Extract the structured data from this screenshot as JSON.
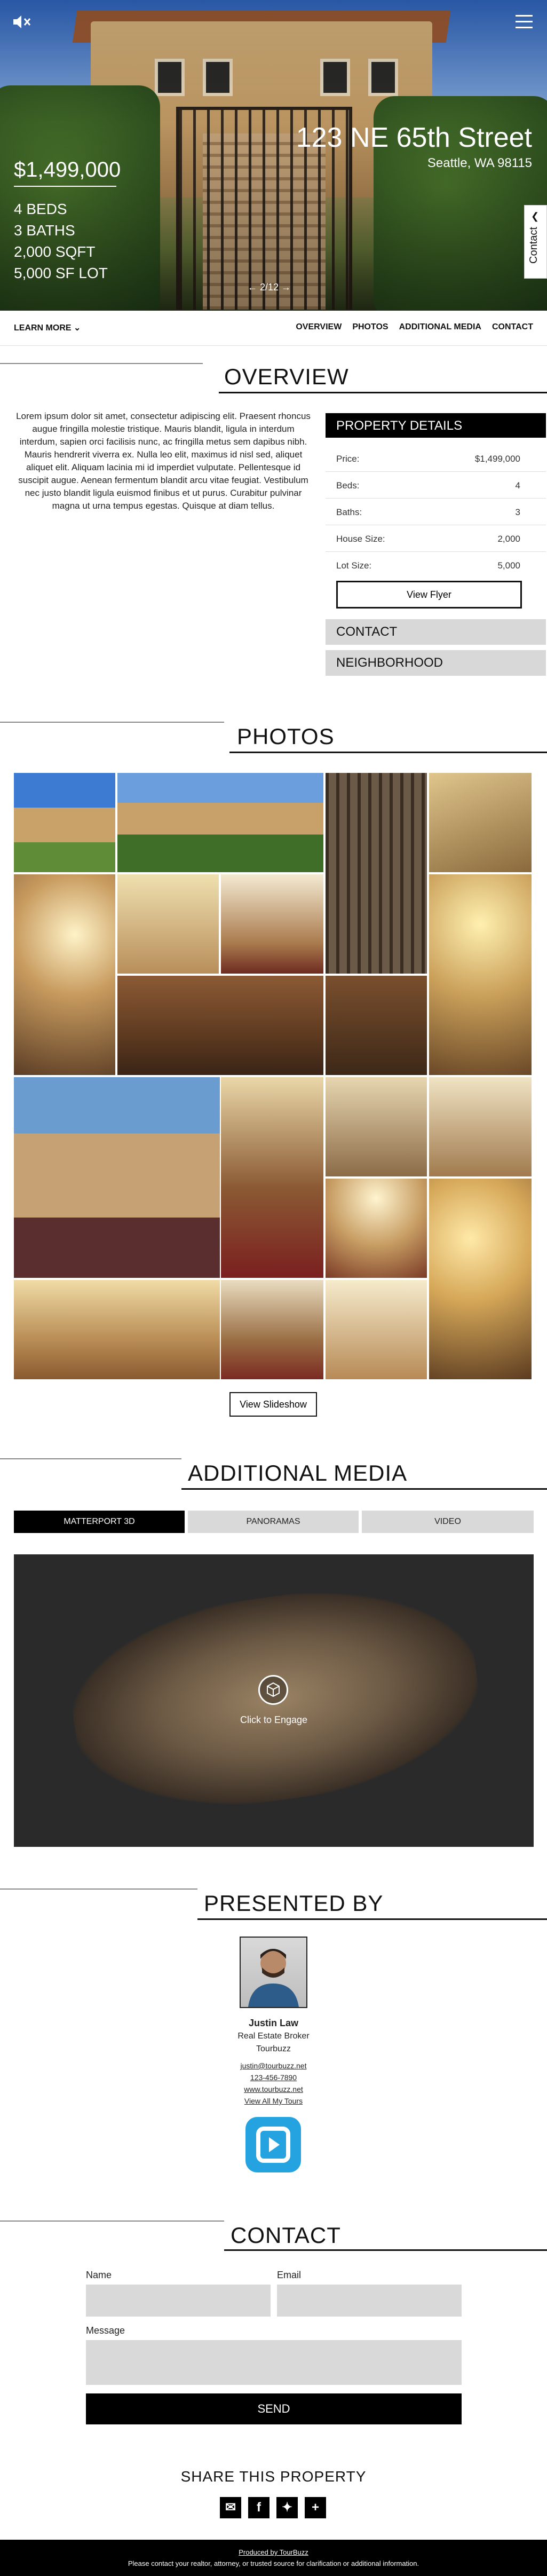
{
  "hero": {
    "price": "$1,499,000",
    "facts": [
      "4 BEDS",
      "3 BATHS",
      "2,000 SQFT",
      "5,000 SF LOT"
    ],
    "street": "123 NE 65th Street",
    "city": "Seattle, WA 98115",
    "contact_tab": "Contact",
    "counter": "← 2/12 →"
  },
  "nav": {
    "learn_more": "LEARN MORE",
    "links": [
      "OVERVIEW",
      "PHOTOS",
      "ADDITIONAL MEDIA",
      "CONTACT"
    ]
  },
  "overview": {
    "title": "OVERVIEW",
    "description": "Lorem ipsum dolor sit amet, consectetur adipiscing elit. Praesent rhoncus augue fringilla molestie tristique. Mauris blandit, ligula in interdum interdum, sapien orci facilisis nunc, ac fringilla metus sem dapibus nibh. Mauris hendrerit viverra ex. Nulla leo elit, maximus id nisl sed, aliquet aliquet elit. Aliquam lacinia mi id imperdiet vulputate. Pellentesque id suscipit augue. Aenean fermentum blandit arcu vitae feugiat. Vestibulum nec justo blandit ligula euismod finibus et ut purus. Curabitur pulvinar magna ut urna tempus egestas. Quisque at diam tellus.",
    "details_title": "PROPERTY DETAILS",
    "details": [
      {
        "label": "Price:",
        "value": "$1,499,000"
      },
      {
        "label": "Beds:",
        "value": "4"
      },
      {
        "label": "Baths:",
        "value": "3"
      },
      {
        "label": "House Size:",
        "value": "2,000"
      },
      {
        "label": "Lot Size:",
        "value": "5,000"
      }
    ],
    "flyer_label": "View Flyer",
    "contact_label": "CONTACT",
    "neighborhood_label": "NEIGHBORHOOD"
  },
  "photos": {
    "title": "PHOTOS",
    "slideshow_label": "View Slideshow"
  },
  "media": {
    "title": "ADDITIONAL MEDIA",
    "tabs": [
      "MATTERPORT 3D",
      "PANORAMAS",
      "VIDEO"
    ],
    "engage": "Click to Engage"
  },
  "presented": {
    "title": "PRESENTED BY",
    "name": "Justin Law",
    "role": "Real Estate Broker",
    "company": "Tourbuzz",
    "email": "justin@tourbuzz.net",
    "phone": "123-456-7890",
    "website": "www.tourbuzz.net",
    "tours_link": "View All My Tours"
  },
  "contact": {
    "title": "CONTACT",
    "name_label": "Name",
    "email_label": "Email",
    "message_label": "Message",
    "send_label": "SEND"
  },
  "share": {
    "title": "SHARE THIS PROPERTY",
    "icons": [
      "email-icon",
      "facebook-icon",
      "twitter-icon",
      "plus-icon"
    ]
  },
  "footer": {
    "produced_by": "Produced by TourBuzz",
    "disclaimer": "Please contact your realtor, attorney, or trusted source for clarification or additional information."
  }
}
